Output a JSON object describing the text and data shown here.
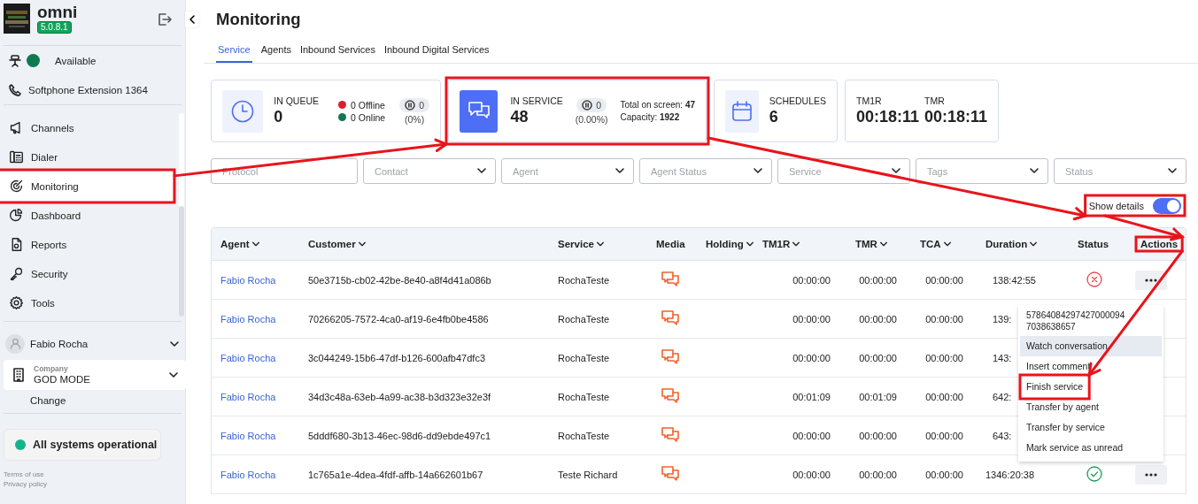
{
  "app": {
    "name": "omni",
    "version": "5.0.8.1"
  },
  "sidebar": {
    "presence": "Available",
    "softphone": "Softphone Extension 1364",
    "nav": [
      {
        "kind": "megaphone",
        "label": "Channels",
        "selected": false,
        "highlighted": false
      },
      {
        "kind": "dialer",
        "label": "Dialer",
        "selected": false,
        "highlighted": false
      },
      {
        "kind": "target",
        "label": "Monitoring",
        "selected": true,
        "highlighted": true
      },
      {
        "kind": "pie",
        "label": "Dashboard",
        "selected": false,
        "highlighted": false
      },
      {
        "kind": "report",
        "label": "Reports",
        "selected": false,
        "highlighted": false
      },
      {
        "kind": "key",
        "label": "Security",
        "selected": false,
        "highlighted": false
      },
      {
        "kind": "gear",
        "label": "Tools",
        "selected": false,
        "highlighted": false
      }
    ],
    "user": "Fabio Rocha",
    "company": {
      "caption": "Company",
      "name": "GOD MODE",
      "action": "Change"
    },
    "system_status": "All systems operational",
    "footer_links": [
      "Terms of use",
      "Privacy policy"
    ]
  },
  "page": {
    "title": "Monitoring",
    "tabs": [
      {
        "label": "Service",
        "selected": true
      },
      {
        "label": "Agents",
        "selected": false
      },
      {
        "label": "Inbound Services",
        "selected": false
      },
      {
        "label": "Inbound Digital Services",
        "selected": false
      }
    ]
  },
  "cards": [
    {
      "kind": "queue",
      "label": "IN QUEUE",
      "value": "0",
      "offline": "0 Offline",
      "online": "0 Online",
      "paused": "0",
      "paused_share": "(0%)",
      "highlighted": false
    },
    {
      "kind": "service",
      "label": "IN SERVICE",
      "value": "48",
      "paused": "0",
      "paused_share": "(0.00%)",
      "total_label": "Total on screen:",
      "total": "47",
      "capacity_label": "Capacity:",
      "capacity": "1922",
      "highlighted": true
    },
    {
      "kind": "schedules",
      "label": "SCHEDULES",
      "value": "6",
      "highlighted": false
    },
    {
      "kind": "times",
      "metrics": [
        {
          "label": "TM1R",
          "value": "00:18:11"
        },
        {
          "label": "TMR",
          "value": "00:18:11"
        }
      ],
      "highlighted": false
    }
  ],
  "filters": [
    {
      "kind": "text",
      "placeholder": "Protocol"
    },
    {
      "kind": "select",
      "placeholder": "Contact"
    },
    {
      "kind": "select",
      "placeholder": "Agent"
    },
    {
      "kind": "select",
      "placeholder": "Agent Status"
    },
    {
      "kind": "select",
      "placeholder": "Service"
    },
    {
      "kind": "select",
      "placeholder": "Tags"
    },
    {
      "kind": "select",
      "placeholder": "Status"
    }
  ],
  "show_details": {
    "label": "Show details",
    "on": true,
    "highlighted": true
  },
  "table": {
    "columns": [
      {
        "label": "Agent",
        "sortable": true,
        "highlighted": false
      },
      {
        "label": "Customer",
        "sortable": true,
        "highlighted": false
      },
      {
        "label": "Service",
        "sortable": true,
        "highlighted": false
      },
      {
        "label": "Media",
        "sortable": false,
        "highlighted": false
      },
      {
        "label": "Holding",
        "sortable": true,
        "highlighted": false
      },
      {
        "label": "TM1R",
        "sortable": true,
        "highlighted": false
      },
      {
        "label": "TMR",
        "sortable": true,
        "highlighted": false
      },
      {
        "label": "TCA",
        "sortable": true,
        "highlighted": false
      },
      {
        "label": "Duration",
        "sortable": true,
        "highlighted": false
      },
      {
        "label": "Status",
        "sortable": false,
        "highlighted": false
      },
      {
        "label": "Actions",
        "sortable": false,
        "highlighted": true
      }
    ],
    "rows": [
      {
        "agent": "Fabio Rocha",
        "customer": "50e3715b-cb02-42be-8e40-a8f4d41a086b",
        "service": "RochaTeste",
        "tm1r": "00:00:00",
        "tmr": "00:00:00",
        "tca": "00:00:00",
        "duration": "138:42:55",
        "status": {
          "kind": "error"
        },
        "actions": true
      },
      {
        "agent": "Fabio Rocha",
        "customer": "70266205-7572-4ca0-af19-6e4fb0be4586",
        "service": "RochaTeste",
        "tm1r": "00:00:00",
        "tmr": "00:00:00",
        "tca": "00:00:00",
        "duration": "139:",
        "actions": false
      },
      {
        "agent": "Fabio Rocha",
        "customer": "3c044249-15b6-47df-b126-600afb47dfc3",
        "service": "RochaTeste",
        "tm1r": "00:00:00",
        "tmr": "00:00:00",
        "tca": "00:00:00",
        "duration": "143:",
        "actions": false
      },
      {
        "agent": "Fabio Rocha",
        "customer": "34d3c48a-63eb-4a99-ac38-b3d323e32e3f",
        "service": "RochaTeste",
        "tm1r": "00:01:09",
        "tmr": "00:01:09",
        "tca": "00:00:00",
        "duration": "642:",
        "actions": false
      },
      {
        "agent": "Fabio Rocha",
        "customer": "5dddf680-3b13-46ec-98d6-dd9ebde497c1",
        "service": "RochaTeste",
        "tm1r": "00:00:00",
        "tmr": "00:00:00",
        "tca": "00:00:00",
        "duration": "643:",
        "actions": false
      },
      {
        "agent": "Fabio Rocha",
        "customer": "1c765a1e-4dea-4fdf-affb-14a662601b67",
        "service": "Teste Richard",
        "tm1r": "00:00:00",
        "tmr": "00:00:00",
        "tca": "00:00:00",
        "duration": "1346:20:38",
        "status": {
          "kind": "ok"
        },
        "actions": true
      }
    ]
  },
  "menu": {
    "items": [
      {
        "kind": "id",
        "label": "578640842974270000947038638657",
        "highlighted": false
      },
      {
        "kind": "action",
        "label": "Watch conversation",
        "hovered": true,
        "highlighted": false
      },
      {
        "kind": "action",
        "label": "Insert comment",
        "hovered": false,
        "highlighted": false
      },
      {
        "kind": "action",
        "label": "Finish service",
        "hovered": false,
        "highlighted": true
      },
      {
        "kind": "action",
        "label": "Transfer by agent",
        "hovered": false,
        "highlighted": false
      },
      {
        "kind": "action",
        "label": "Transfer by service",
        "hovered": false,
        "highlighted": false
      },
      {
        "kind": "action",
        "label": "Mark service as unread",
        "hovered": false,
        "highlighted": false
      }
    ]
  }
}
